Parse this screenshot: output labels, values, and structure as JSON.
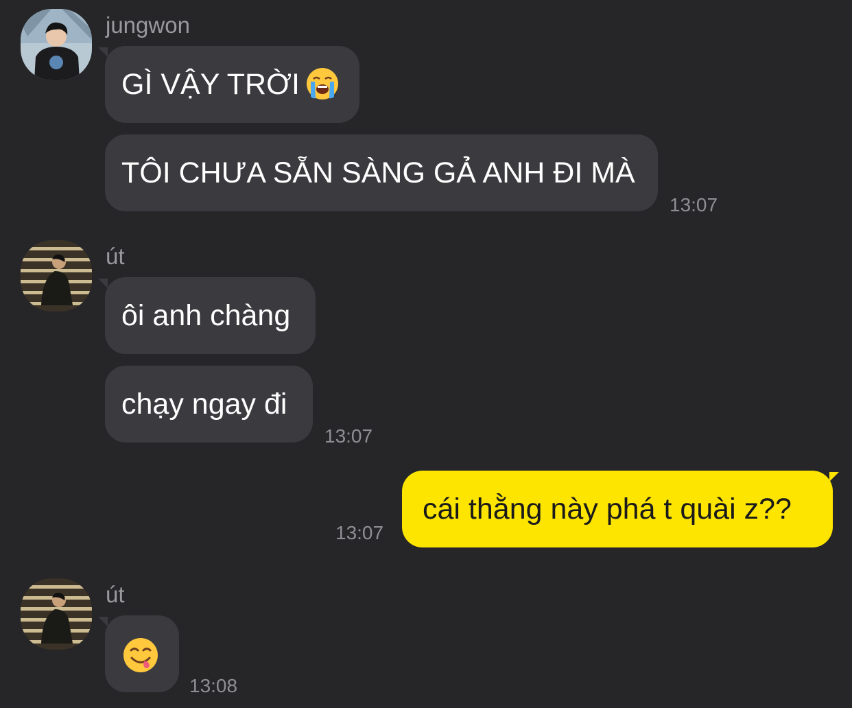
{
  "messages": {
    "group1": {
      "sender": "jungwon",
      "bubble1_text": "GÌ VẬY TRỜI",
      "bubble1_emoji": "loudly-crying-face",
      "bubble2_text": "TÔI CHƯA SẴN SÀNG GẢ ANH ĐI MÀ",
      "time": "13:07"
    },
    "group2": {
      "sender": "út",
      "bubble1_text": "ôi anh chàng",
      "bubble2_text": "chạy ngay đi",
      "time": "13:07"
    },
    "outgoing": {
      "text": "cái thằng này phá t quài z??",
      "time": "13:07"
    },
    "group3": {
      "sender": "út",
      "emoji": "face-savoring-food",
      "time": "13:08"
    }
  },
  "colors": {
    "background": "#262629",
    "incoming_bubble": "#3b3b3f",
    "outgoing_bubble": "#fee500",
    "sender_name": "#9a9a9e",
    "timestamp": "#8e8e93"
  }
}
